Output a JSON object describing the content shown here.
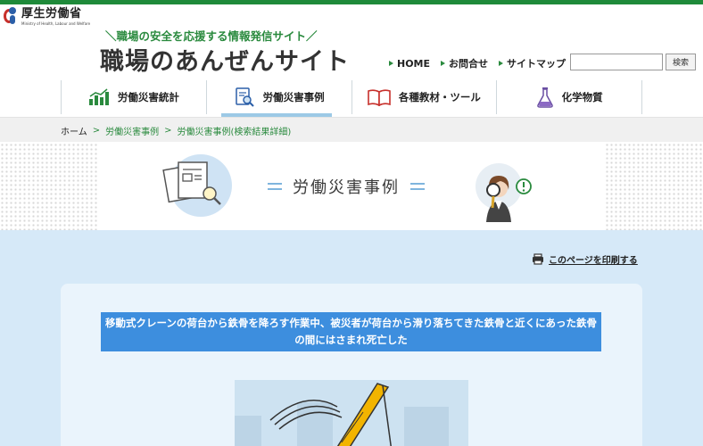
{
  "ministry": {
    "name": "厚生労働省",
    "name_en": "Ministry of Health, Labour and Welfare"
  },
  "site": {
    "tagline": "＼職場の安全を応援する情報発信サイト／",
    "title": "職場のあんぜんサイト"
  },
  "header_links": [
    {
      "label": "HOME"
    },
    {
      "label": "お問合せ"
    },
    {
      "label": "サイトマップ"
    }
  ],
  "search": {
    "value": "",
    "button_label": "検索"
  },
  "nav": [
    {
      "label": "労働災害統計",
      "icon": "bar-chart-icon",
      "active": false
    },
    {
      "label": "労働災害事例",
      "icon": "document-search-icon",
      "active": true
    },
    {
      "label": "各種教材・ツール",
      "icon": "book-icon",
      "active": false
    },
    {
      "label": "化学物質",
      "icon": "flask-icon",
      "active": false
    }
  ],
  "breadcrumb": {
    "home": "ホーム",
    "separator": ">",
    "items": [
      "労働災害事例",
      "労働災害事例(検索結果詳細)"
    ]
  },
  "hero": {
    "title": "労働災害事例"
  },
  "print": {
    "label": "このページを印刷する"
  },
  "case": {
    "title": "移動式クレーンの荷台から鉄骨を降ろす作業中、被災者が荷台から滑り落ちてきた鉄骨と近くにあった鉄骨の間にはさまれ死亡した"
  },
  "colors": {
    "brand_green": "#1f8a3a",
    "accent_blue": "#3d8ede",
    "main_bg": "#d6e9f8"
  }
}
